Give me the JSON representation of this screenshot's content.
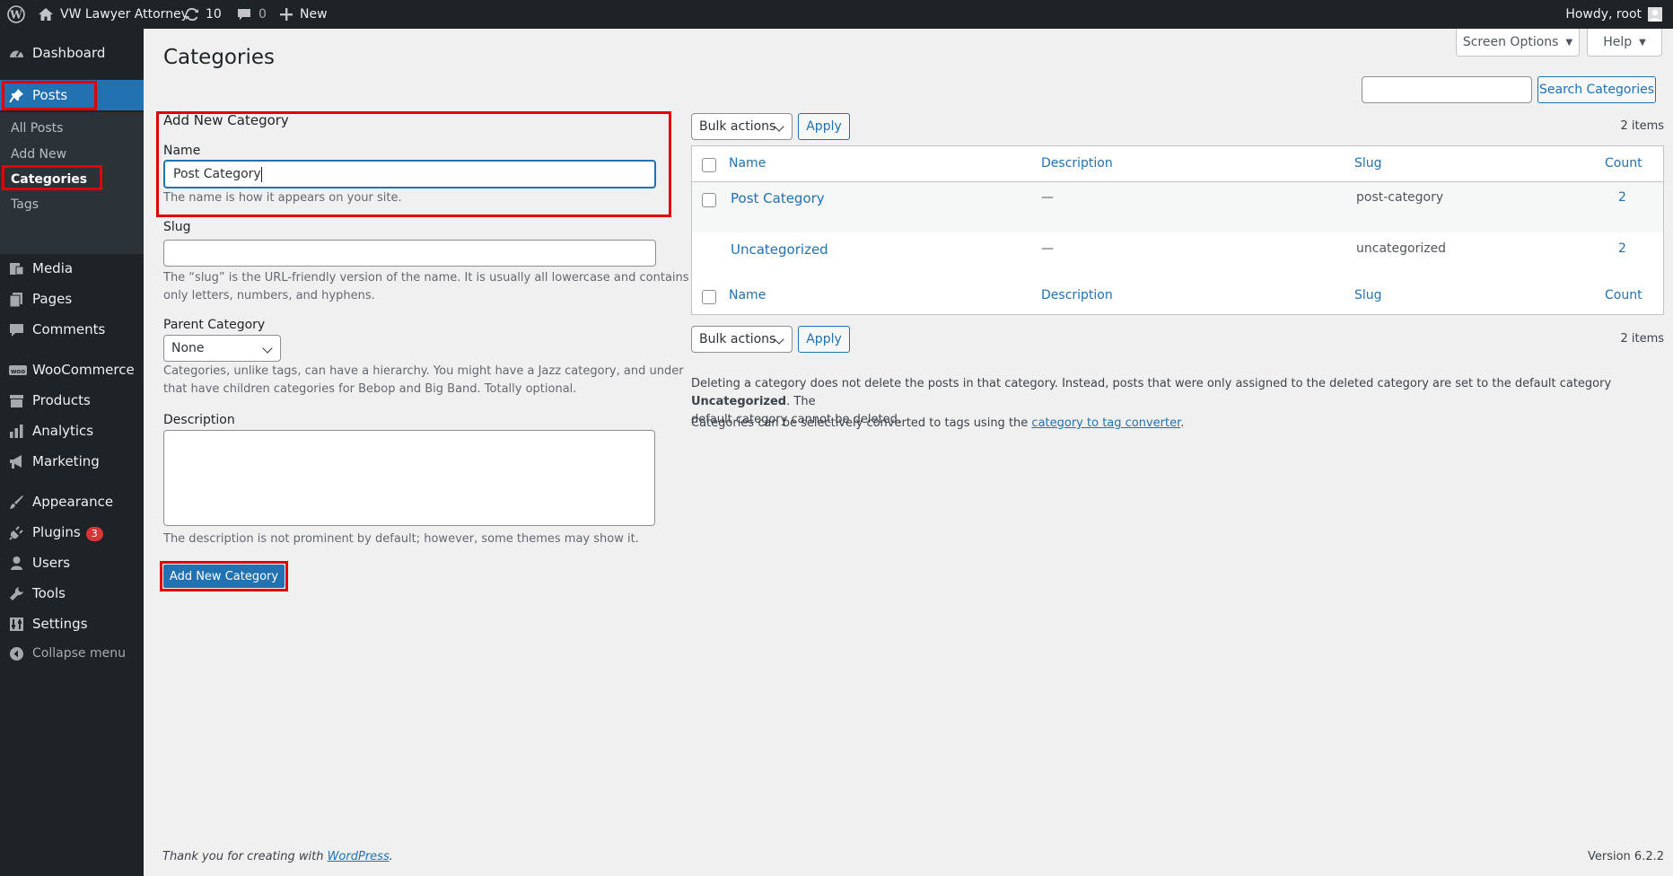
{
  "adminbar": {
    "site_name": "VW Lawyer Attorney",
    "updates_count": "10",
    "comments_count": "0",
    "new_label": "New",
    "greeting": "Howdy, root"
  },
  "sidebar": {
    "dashboard": "Dashboard",
    "posts": "Posts",
    "sub_all_posts": "All Posts",
    "sub_add_new": "Add New",
    "sub_categories": "Categories",
    "sub_tags": "Tags",
    "media": "Media",
    "pages": "Pages",
    "comments": "Comments",
    "woocommerce": "WooCommerce",
    "products": "Products",
    "analytics": "Analytics",
    "marketing": "Marketing",
    "appearance": "Appearance",
    "plugins": "Plugins",
    "plugins_badge": "3",
    "users": "Users",
    "tools": "Tools",
    "settings": "Settings",
    "collapse": "Collapse menu"
  },
  "header": {
    "screen_options": "Screen Options",
    "help": "Help",
    "page_title": "Categories",
    "search_button": "Search Categories",
    "search_value": ""
  },
  "form": {
    "heading": "Add New Category",
    "name_label": "Name",
    "name_value": "Post Category",
    "name_help": "The name is how it appears on your site.",
    "slug_label": "Slug",
    "slug_value": "",
    "slug_help_1": "The “slug” is the URL-friendly version of the name. It is usually all lowercase and contains",
    "slug_help_2": "only letters, numbers, and hyphens.",
    "parent_label": "Parent Category",
    "parent_selected": "None",
    "parent_help_1": "Categories, unlike tags, can have a hierarchy. You might have a Jazz category, and under",
    "parent_help_2": "that have children categories for Bebop and Big Band. Totally optional.",
    "description_label": "Description",
    "description_value": "",
    "description_help": "The description is not prominent by default; however, some themes may show it.",
    "submit_label": "Add New Category"
  },
  "table": {
    "bulk_actions": "Bulk actions",
    "apply": "Apply",
    "items_count": "2 items",
    "columns": {
      "name": "Name",
      "description": "Description",
      "slug": "Slug",
      "count": "Count"
    },
    "rows": [
      {
        "name": "Post Category",
        "description": "—",
        "slug": "post-category",
        "count": "2"
      },
      {
        "name": "Uncategorized",
        "description": "—",
        "slug": "uncategorized",
        "count": "2"
      }
    ]
  },
  "notes": {
    "note1_a": "Deleting a category does not delete the posts in that category. Instead, posts that were only assigned to the deleted category are set to the default category ",
    "note1_bold": "Uncategorized",
    "note1_b": ". The",
    "note1_c": "default category cannot be deleted.",
    "note2_a": "Categories can be selectively converted to tags using the ",
    "note2_link": "category to tag converter",
    "note2_b": "."
  },
  "footer": {
    "thanks_prefix": "Thank you for creating with ",
    "thanks_link": "WordPress",
    "thanks_suffix": ".",
    "version": "Version 6.2.2"
  },
  "colors": {
    "adminbar_bg": "#1d2327",
    "accent": "#2271b1",
    "highlight_box": "#e30000",
    "badge": "#d63638"
  }
}
